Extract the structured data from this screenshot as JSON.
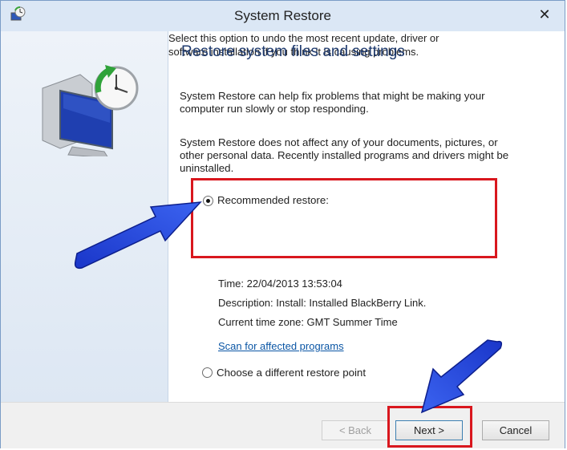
{
  "window": {
    "title": "System Restore",
    "close_glyph": "✕",
    "app_icon": "system-restore-icon"
  },
  "content": {
    "heading": "Restore system files and settings",
    "paragraph1": "System Restore can help fix problems that might be making your computer run slowly or stop responding.",
    "paragraph2": "System Restore does not affect any of your documents, pictures, or other personal data. Recently installed programs and drivers might be uninstalled.",
    "recommended": {
      "label": "Recommended restore:",
      "selected": true,
      "description": "Select this option to undo the most recent update, driver or software installation if you think it is causing problems."
    },
    "info": {
      "time": "Time: 22/04/2013 13:53:04",
      "description": "Description: Install: Installed BlackBerry Link.",
      "timezone": "Current time zone: GMT Summer Time"
    },
    "scan_link": "Scan for affected programs",
    "different": {
      "label": "Choose a different restore point",
      "selected": false
    }
  },
  "footer": {
    "back_label": "< Back",
    "next_label": "Next >",
    "cancel_label": "Cancel"
  },
  "annotations": {
    "highlight_color": "#d9171e",
    "arrow_color": "#1f3fd6"
  }
}
